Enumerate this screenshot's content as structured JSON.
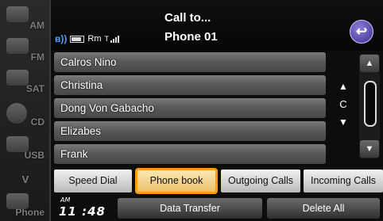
{
  "sources": [
    {
      "label": "AM",
      "icon": "radio-am-icon"
    },
    {
      "label": "FM",
      "icon": "radio-fm-icon"
    },
    {
      "label": "SAT",
      "icon": "satellite-icon"
    },
    {
      "label": "CD",
      "icon": "cd-disc-icon"
    },
    {
      "label": "USB",
      "icon": "usb-icon"
    },
    {
      "label": "V",
      "icon": "more-chevron-icon"
    },
    {
      "label": "Phone",
      "icon": "phone-icon"
    }
  ],
  "header": {
    "title_line1": "Call to...",
    "title_line2": "Phone 01",
    "roaming": "Rm",
    "back_icon": "↩"
  },
  "contacts": [
    "Calros Nino",
    "Christina",
    "Dong Von Gabacho",
    "Elizabes",
    "Frank"
  ],
  "index": {
    "up": "▲",
    "letter": "C",
    "down": "▼"
  },
  "scroll": {
    "up": "▲",
    "down": "▼"
  },
  "tabs": {
    "speed_dial": "Speed Dial",
    "phone_book": "Phone book",
    "outgoing": "Outgoing Calls",
    "incoming": "Incoming Calls",
    "active": "phone_book"
  },
  "clock": {
    "ampm": "AM",
    "time": "11 :48"
  },
  "buttons": {
    "data_transfer": "Data Transfer",
    "delete_all": "Delete All"
  },
  "colors": {
    "accent_highlight": "#ff9a1b",
    "bluetooth": "#4aa3ff",
    "back_button": "#5a4cc0"
  }
}
